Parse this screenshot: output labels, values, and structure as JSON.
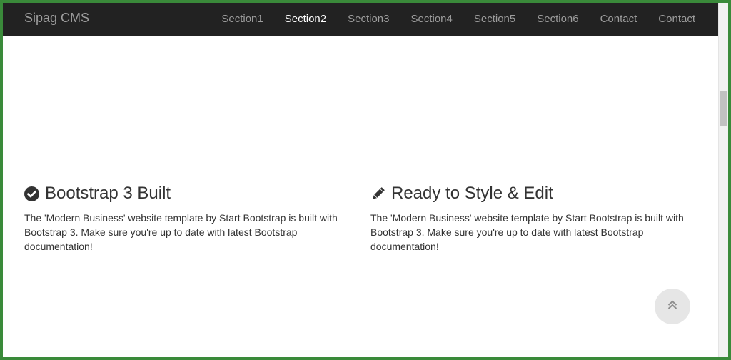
{
  "brand": "Sipag CMS",
  "nav": {
    "items": [
      "Section1",
      "Section2",
      "Section3",
      "Section4",
      "Section5",
      "Section6",
      "Contact",
      "Contact"
    ],
    "active_index": 1
  },
  "features": [
    {
      "icon": "check-circle-icon",
      "title": "Bootstrap 3 Built",
      "text": "The 'Modern Business' website template by Start Bootstrap is built with Bootstrap 3. Make sure you're up to date with latest Bootstrap documentation!"
    },
    {
      "icon": "pencil-icon",
      "title": "Ready to Style & Edit",
      "text": "The 'Modern Business' website template by Start Bootstrap is built with Bootstrap 3. Make sure you're up to date with latest Bootstrap documentation!"
    }
  ],
  "scroll_top_icon": "double-chevron-up-icon",
  "colors": {
    "navbar_bg": "#222222",
    "nav_text": "#9d9d9d",
    "nav_active": "#ffffff",
    "frame_border": "#3a8a3a",
    "body_text": "#333333"
  }
}
